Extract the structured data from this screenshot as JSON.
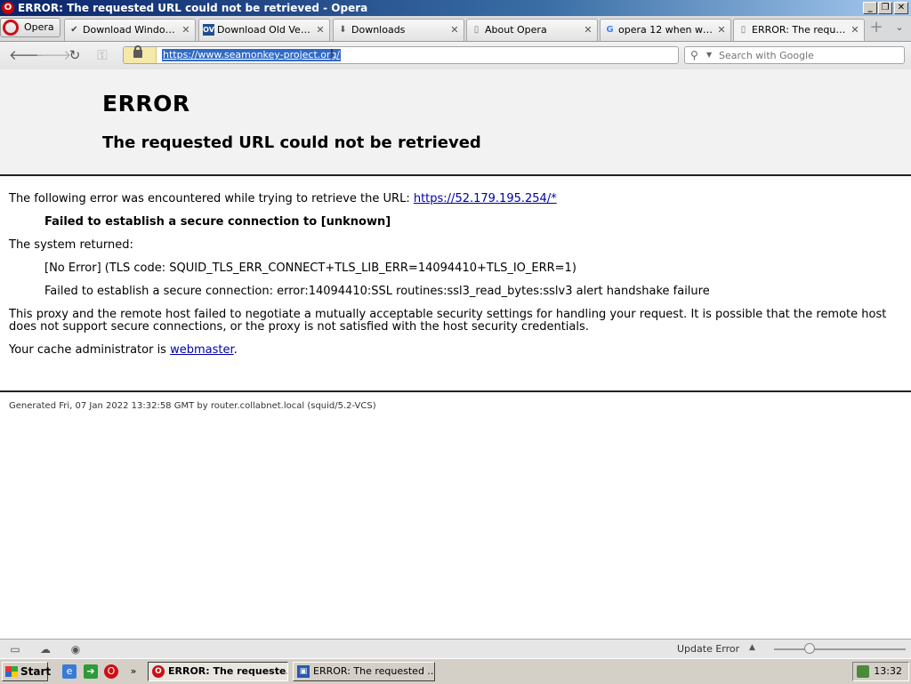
{
  "window": {
    "title": "ERROR: The requested URL could not be retrieved - Opera",
    "app_icon": "opera-icon",
    "buttons": {
      "minimize": "_",
      "maximize": "❐",
      "close": "✕"
    }
  },
  "browser": {
    "menu_label": "Opera",
    "tabs": [
      {
        "label": "Download Windows ...",
        "icon": "edge-like-icon",
        "active": false
      },
      {
        "label": "Download Old Versi...",
        "icon": "ov-site-icon",
        "active": false
      },
      {
        "label": "Downloads",
        "icon": "downloads-icon",
        "active": false
      },
      {
        "label": "About Opera",
        "icon": "page-icon",
        "active": false
      },
      {
        "label": "opera 12 when was...",
        "icon": "google-icon",
        "active": false
      },
      {
        "label": "ERROR: The reques...",
        "icon": "page-icon",
        "active": true
      }
    ],
    "close_glyph": "✕",
    "address": {
      "url": "https://www.seamonkey-project.org/"
    },
    "search": {
      "placeholder": "Search with Google"
    }
  },
  "page": {
    "heading": "ERROR",
    "subheading": "The requested URL could not be retrieved",
    "intro": "The following error was encountered while trying to retrieve the URL: ",
    "intro_link": "https://52.179.195.254/*",
    "error_line": "Failed to establish a secure connection to [unknown]",
    "system_returned": "The system returned:",
    "tls_code": "[No Error] (TLS code: SQUID_TLS_ERR_CONNECT+TLS_LIB_ERR=14094410+TLS_IO_ERR=1)",
    "ssl_error": "Failed to establish a secure connection: error:14094410:SSL routines:ssl3_read_bytes:sslv3 alert handshake failure",
    "explanation": "This proxy and the remote host failed to negotiate a mutually acceptable security settings for handling your request. It is possible that the remote host does not support secure connections, or the proxy is not satisfied with the host security credentials.",
    "admin_prefix": "Your cache administrator is ",
    "admin_link": "webmaster",
    "admin_suffix": ".",
    "footer": "Generated Fri, 07 Jan 2022 13:32:58 GMT by router.collabnet.local (squid/5.2-VCS)"
  },
  "statusbar": {
    "status_text": "Update Error"
  },
  "taskbar": {
    "start_label": "Start",
    "items": [
      {
        "label": "ERROR: The requeste...",
        "pressed": true
      },
      {
        "label": "ERROR: The requested ...",
        "pressed": false
      }
    ],
    "clock": "13:32"
  }
}
